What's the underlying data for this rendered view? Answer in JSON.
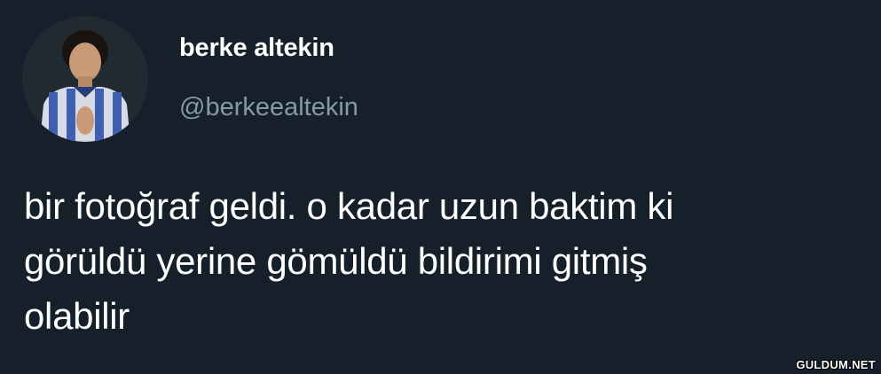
{
  "theme": {
    "background": "#15202b",
    "text_primary": "#ffffff",
    "text_secondary": "#8899a6"
  },
  "user": {
    "display_name": "berke altekin",
    "handle": "@berkeealtekin",
    "avatar_icon": "user-avatar-icon"
  },
  "tweet": {
    "lines": [
      "bir fotoğraf geldi. o kadar uzun baktim ki",
      "görüldü yerine gömüldü bildirimi gitmiş",
      "olabilir"
    ]
  },
  "watermark": {
    "text": "GULDUM.NET"
  }
}
